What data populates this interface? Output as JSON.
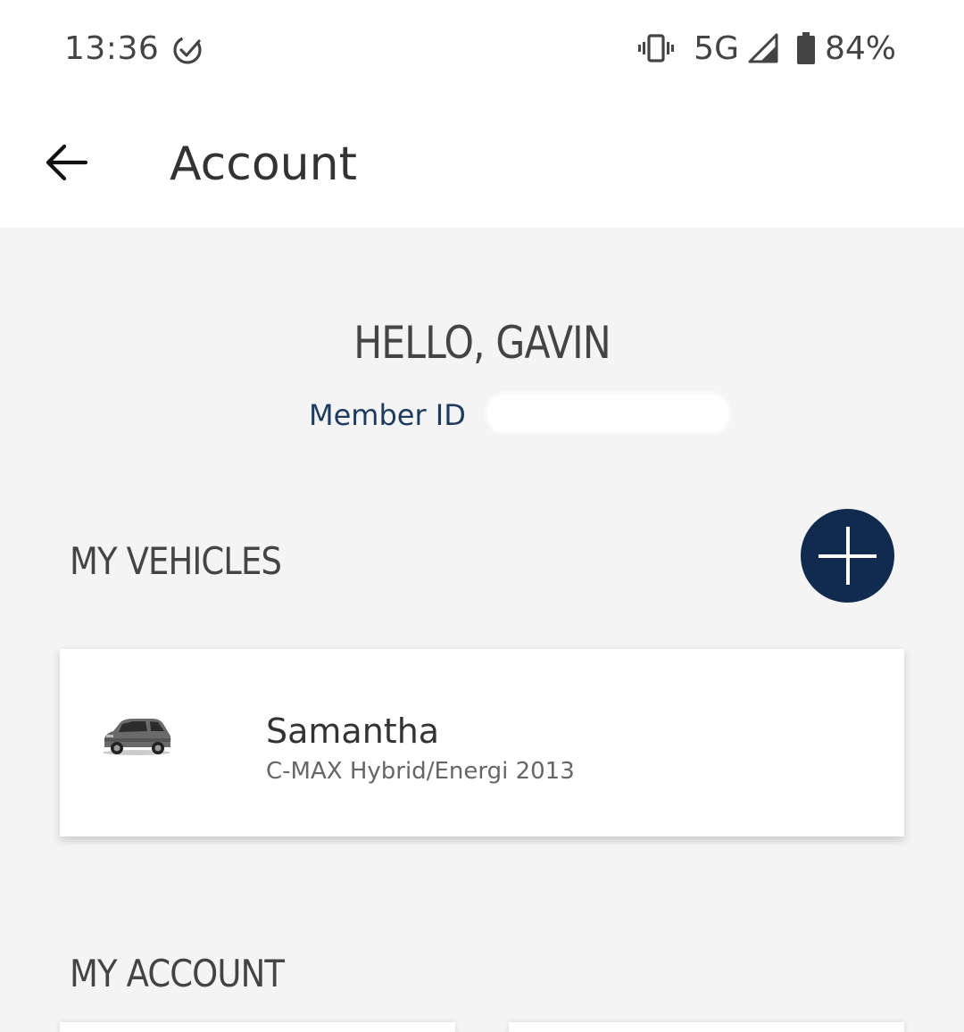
{
  "status_bar": {
    "time": "13:36",
    "network": "5G",
    "battery_percent": "84%",
    "icons": [
      "check-circle-icon",
      "vibrate-icon",
      "signal-icon",
      "battery-icon"
    ]
  },
  "app_bar": {
    "title": "Account",
    "back_icon": "arrow-left-icon"
  },
  "greeting": "HELLO, GAVIN",
  "member": {
    "label": "Member ID"
  },
  "vehicles_section": {
    "title": "MY VEHICLES",
    "add_icon": "plus-icon",
    "vehicles": [
      {
        "name": "Samantha",
        "model": "C-MAX Hybrid/Energi 2013"
      }
    ]
  },
  "account_section": {
    "title": "MY ACCOUNT"
  },
  "colors": {
    "accent": "#112b4e",
    "member_label": "#1d3b5c",
    "background": "#f4f4f4",
    "card": "#ffffff"
  }
}
